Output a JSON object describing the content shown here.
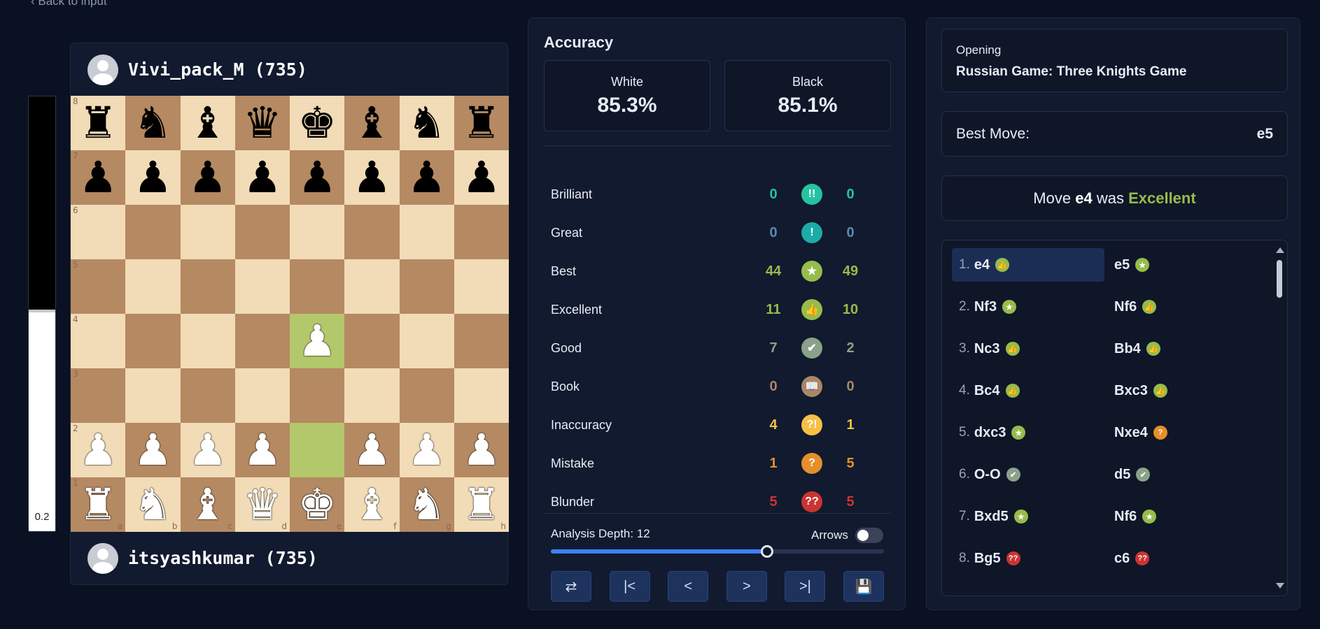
{
  "nav": {
    "back_label": "Back to input"
  },
  "eval": {
    "score": "0.2",
    "white_fraction": 0.51
  },
  "players": {
    "top": {
      "name": "Vivi_pack_M (735)"
    },
    "bottom": {
      "name": "itsyashkumar (735)"
    }
  },
  "board": {
    "position": [
      [
        "r",
        "n",
        "b",
        "q",
        "k",
        "b",
        "n",
        "r"
      ],
      [
        "p",
        "p",
        "p",
        "p",
        "p",
        "p",
        "p",
        "p"
      ],
      [
        "",
        "",
        "",
        "",
        "",
        "",
        "",
        ""
      ],
      [
        "",
        "",
        "",
        "",
        "",
        "",
        "",
        ""
      ],
      [
        "",
        "",
        "",
        "",
        "P",
        "",
        "",
        ""
      ],
      [
        "",
        "",
        "",
        "",
        "",
        "",
        "",
        ""
      ],
      [
        "P",
        "P",
        "P",
        "P",
        "",
        "P",
        "P",
        "P"
      ],
      [
        "R",
        "N",
        "B",
        "Q",
        "K",
        "B",
        "N",
        "R"
      ]
    ],
    "highlighted": [
      "e4",
      "e2"
    ],
    "rank_labels": [
      "8",
      "7",
      "6",
      "5",
      "4",
      "3",
      "2",
      "1"
    ],
    "file_labels": [
      "a",
      "b",
      "c",
      "d",
      "e",
      "f",
      "g",
      "h"
    ]
  },
  "accuracy": {
    "title": "Accuracy",
    "white_label": "White",
    "white_value": "85.3%",
    "black_label": "Black",
    "black_value": "85.1%",
    "classifications": [
      {
        "name": "Brilliant",
        "white": "0",
        "black": "0",
        "color": "#26c2a3",
        "icon": "double-exclamation-icon",
        "glyph": "!!"
      },
      {
        "name": "Great",
        "white": "0",
        "black": "0",
        "color": "#5b8bb0",
        "icon": "exclamation-icon",
        "glyph": "!",
        "icon_color": "#1baca6"
      },
      {
        "name": "Best",
        "white": "44",
        "black": "49",
        "color": "#96bc4b",
        "icon": "star-icon",
        "glyph": "★"
      },
      {
        "name": "Excellent",
        "white": "11",
        "black": "10",
        "color": "#96bc4b",
        "icon": "thumbs-up-icon",
        "glyph": "👍"
      },
      {
        "name": "Good",
        "white": "7",
        "black": "2",
        "color": "#8ba18a",
        "icon": "check-icon",
        "glyph": "✔"
      },
      {
        "name": "Book",
        "white": "0",
        "black": "0",
        "color": "#a88865",
        "icon": "book-icon",
        "glyph": "📖"
      },
      {
        "name": "Inaccuracy",
        "white": "4",
        "black": "1",
        "color": "#f7c045",
        "icon": "question-exclamation-icon",
        "glyph": "?!"
      },
      {
        "name": "Mistake",
        "white": "1",
        "black": "5",
        "color": "#e58f2a",
        "icon": "question-icon",
        "glyph": "?"
      },
      {
        "name": "Blunder",
        "white": "5",
        "black": "5",
        "color": "#ca3431",
        "icon": "double-question-icon",
        "glyph": "??"
      }
    ],
    "depth_label": "Analysis Depth: 12",
    "depth_fraction": 0.65,
    "arrows_label": "Arrows",
    "arrows_on": false,
    "controls": [
      {
        "name": "flip-board-button",
        "icon": "swap-icon",
        "glyph": "⇄"
      },
      {
        "name": "first-move-button",
        "icon": "skip-back-icon",
        "glyph": "|<"
      },
      {
        "name": "prev-move-button",
        "icon": "chevron-left-icon",
        "glyph": "<"
      },
      {
        "name": "next-move-button",
        "icon": "chevron-right-icon",
        "glyph": ">"
      },
      {
        "name": "last-move-button",
        "icon": "skip-forward-icon",
        "glyph": ">|"
      },
      {
        "name": "save-button",
        "icon": "save-icon",
        "glyph": "💾"
      }
    ]
  },
  "opening": {
    "label": "Opening",
    "name": "Russian Game: Three Knights Game"
  },
  "best_move": {
    "label": "Best Move:",
    "value": "e5"
  },
  "move_feedback": {
    "prefix": "Move",
    "move": "e4",
    "middle": "was",
    "quality": "Excellent"
  },
  "moves": [
    {
      "num": "1.",
      "white": "e4",
      "white_cls": "excellent",
      "black": "e5",
      "black_cls": "best"
    },
    {
      "num": "2.",
      "white": "Nf3",
      "white_cls": "best",
      "black": "Nf6",
      "black_cls": "excellent"
    },
    {
      "num": "3.",
      "white": "Nc3",
      "white_cls": "excellent",
      "black": "Bb4",
      "black_cls": "excellent"
    },
    {
      "num": "4.",
      "white": "Bc4",
      "white_cls": "excellent",
      "black": "Bxc3",
      "black_cls": "excellent"
    },
    {
      "num": "5.",
      "white": "dxc3",
      "white_cls": "best",
      "black": "Nxe4",
      "black_cls": "mistake"
    },
    {
      "num": "6.",
      "white": "O-O",
      "white_cls": "good",
      "black": "d5",
      "black_cls": "good"
    },
    {
      "num": "7.",
      "white": "Bxd5",
      "white_cls": "best",
      "black": "Nf6",
      "black_cls": "best"
    },
    {
      "num": "8.",
      "white": "Bg5",
      "white_cls": "blunder",
      "black": "c6",
      "black_cls": "blunder"
    }
  ],
  "selected_move": "1-white"
}
